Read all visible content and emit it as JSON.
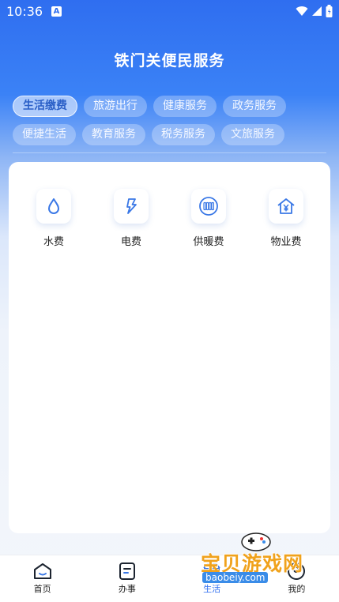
{
  "status_bar": {
    "time": "10:36",
    "notif": "A"
  },
  "header": {
    "title": "铁门关便民服务"
  },
  "categories": [
    {
      "label": "生活缴费",
      "active": true
    },
    {
      "label": "旅游出行"
    },
    {
      "label": "健康服务"
    },
    {
      "label": "政务服务"
    },
    {
      "label": "便捷生活"
    },
    {
      "label": "教育服务"
    },
    {
      "label": "税务服务"
    },
    {
      "label": "文旅服务"
    }
  ],
  "services": [
    {
      "label": "水费",
      "icon": "water-drop-icon"
    },
    {
      "label": "电费",
      "icon": "lightning-icon"
    },
    {
      "label": "供暖费",
      "icon": "radiator-icon"
    },
    {
      "label": "物业费",
      "icon": "house-yen-icon"
    }
  ],
  "tabbar": [
    {
      "label": "首页",
      "icon": "home-icon"
    },
    {
      "label": "办事",
      "icon": "document-icon"
    },
    {
      "label": "生活",
      "icon": "life-icon",
      "active": true
    },
    {
      "label": "我的",
      "icon": "user-icon"
    }
  ],
  "watermark": {
    "text": "宝贝游戏网",
    "url": "baobeiy.com"
  },
  "colors": {
    "primary": "#2f6ef0",
    "icon_blue": "#3a78e6"
  }
}
